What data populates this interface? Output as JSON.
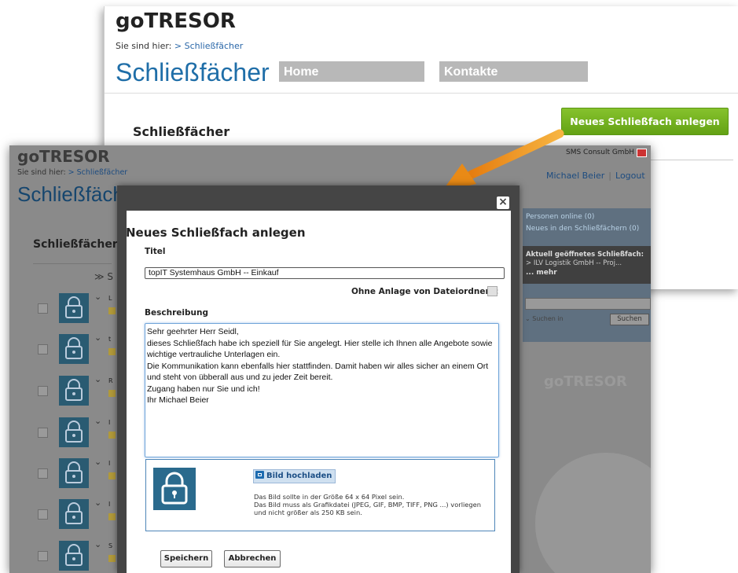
{
  "back_window": {
    "brand": "goTRESOR",
    "breadcrumb_prefix": "Sie sind hier:",
    "breadcrumb_link": "> Schließfächer",
    "page_title": "Schließfächer",
    "nav": [
      "Home",
      "Kontakte"
    ],
    "section_heading": "Schließfächer",
    "new_button_label": "Neues Schließfach anlegen"
  },
  "front_window": {
    "brand": "goTRESOR",
    "breadcrumb_prefix": "Sie sind hier:",
    "breadcrumb_link": "> Schließfächer",
    "page_title": "Schließfäch",
    "company": "SMS Consult GmbH",
    "user_name": "Michael Beier",
    "logout_label": "Logout",
    "section_heading": "Schließfächer",
    "sort_label": "S",
    "rows": [
      {
        "mini": "L"
      },
      {
        "mini": "t"
      },
      {
        "mini": "R"
      },
      {
        "mini": "I"
      },
      {
        "mini": "I"
      },
      {
        "mini": "I"
      },
      {
        "mini": "S"
      }
    ],
    "sidebar": {
      "online": "Personen online (0)",
      "news": "Neues in den Schließfächern (0)",
      "current_heading": "Aktuell geöffnetes Schließfach:",
      "current_item": "> ILV Logistik GmbH -- Proj...",
      "more": "... mehr",
      "search_in": "Suchen in",
      "search_button": "Suchen",
      "logo": "goTRESOR"
    }
  },
  "modal": {
    "title": "Neues Schließfach anlegen",
    "close_label": "×",
    "titel_label": "Titel",
    "titel_value": "topIT Systemhaus GmbH -- Einkauf",
    "ohne_anlage_label": "Ohne Anlage von Dateiordnern:",
    "beschreibung_label": "Beschreibung",
    "beschreibung_value": "Sehr geehrter Herr Seidl,\ndieses Schließfach habe ich speziell für Sie angelegt. Hier stelle ich Ihnen alle Angebote sowie wichtige vertrauliche Unterlagen ein.\nDie Kommunikation kann ebenfalls hier stattfinden. Damit haben wir alles sicher an einem Ort und steht von übberall aus und zu jeder Zeit bereit.\nZugang haben nur Sie und ich!\nIhr Michael Beier",
    "upload_button": "Bild hochladen",
    "upload_info_1": "Das Bild sollte in der Größe 64 x 64 Pixel sein.",
    "upload_info_2": "Das Bild muss als Grafikdatei (JPEG, GIF, BMP, TIFF, PNG ...) vorliegen und nicht größer als 250 KB sein.",
    "save_label": "Speichern",
    "cancel_label": "Abbrechen"
  },
  "colors": {
    "accent_green": "#6fb11c",
    "title_blue": "#1f6ea8",
    "lock_blue": "#2a6a8d",
    "arrow_orange": "#f29a1e"
  }
}
